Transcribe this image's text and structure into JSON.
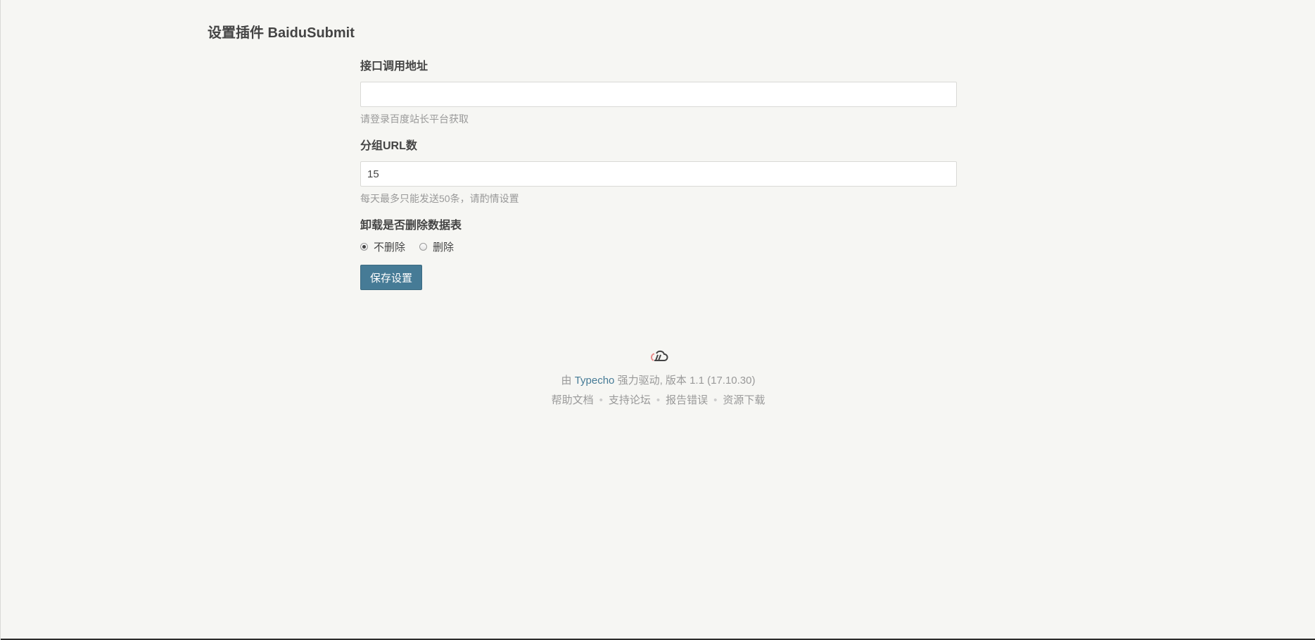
{
  "page": {
    "title": "设置插件 BaiduSubmit"
  },
  "form": {
    "api_url": {
      "label": "接口调用地址",
      "value": "",
      "placeholder": "",
      "hint": "请登录百度站长平台获取"
    },
    "group_url_count": {
      "label": "分组URL数",
      "value": "15",
      "hint": "每天最多只能发送50条，请酌情设置"
    },
    "delete_on_uninstall": {
      "label": "卸载是否删除数据表",
      "options": [
        {
          "label": "不删除",
          "checked": true
        },
        {
          "label": "删除",
          "checked": false
        }
      ]
    },
    "submit_label": "保存设置"
  },
  "footer": {
    "powered_prefix": "由",
    "typecho_link": "Typecho",
    "powered_suffix": "强力驱动, 版本 1.1 (17.10.30)",
    "links": [
      "帮助文档",
      "支持论坛",
      "报告错误",
      "资源下载"
    ],
    "logo_icon": "typecho-cloud-logo-icon"
  },
  "colors": {
    "background": "#f6f6f3",
    "accent": "#467b96",
    "text": "#444444",
    "muted": "#999999"
  }
}
